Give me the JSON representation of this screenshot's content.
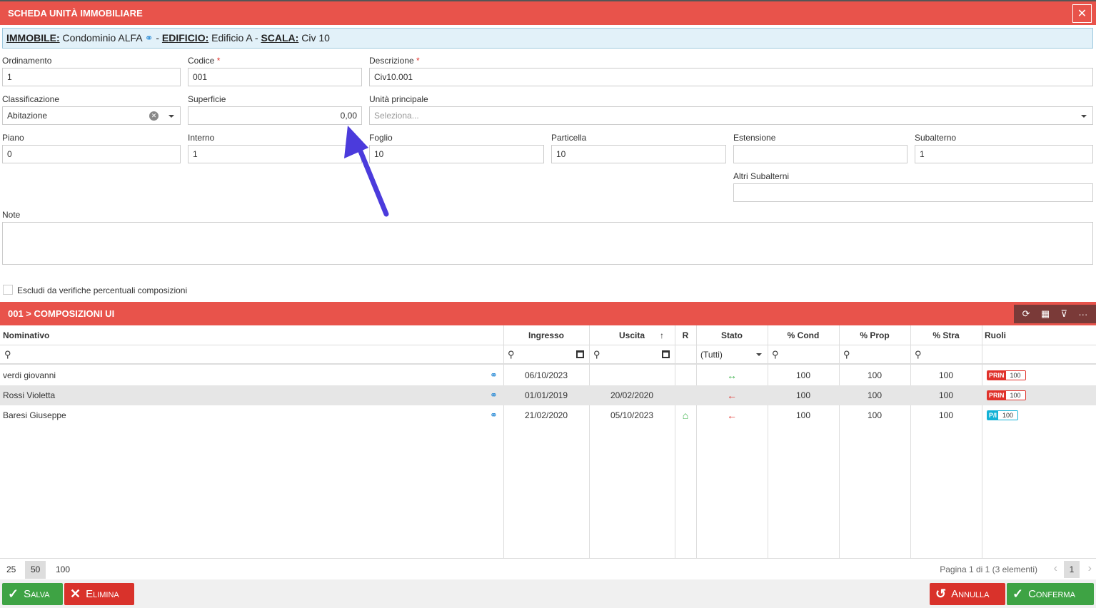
{
  "window": {
    "title": "SCHEDA UNITÀ IMMOBILIARE",
    "close_icon": "close-icon"
  },
  "info": {
    "immobile_label": "IMMOBILE:",
    "immobile_value": "Condominio ALFA",
    "edificio_label": "EDIFICIO:",
    "edificio_value": "Edificio A",
    "scala_label": "SCALA:",
    "scala_value": "Civ 10",
    "sep": "-"
  },
  "form": {
    "ordinamento": {
      "label": "Ordinamento",
      "value": "1"
    },
    "codice": {
      "label": "Codice",
      "value": "001",
      "req": "*"
    },
    "descrizione": {
      "label": "Descrizione",
      "value": "Civ10.001",
      "req": "*"
    },
    "classificazione": {
      "label": "Classificazione",
      "value": "Abitazione"
    },
    "superficie": {
      "label": "Superficie",
      "value": "0,00"
    },
    "unita_principale": {
      "label": "Unità principale",
      "placeholder": "Seleziona..."
    },
    "piano": {
      "label": "Piano",
      "value": "0"
    },
    "interno": {
      "label": "Interno",
      "value": "1"
    },
    "foglio": {
      "label": "Foglio",
      "value": "10"
    },
    "particella": {
      "label": "Particella",
      "value": "10"
    },
    "estensione": {
      "label": "Estensione",
      "value": ""
    },
    "subalterno": {
      "label": "Subalterno",
      "value": "1"
    },
    "altri_subalterni": {
      "label": "Altri Subalterni",
      "value": ""
    },
    "note": {
      "label": "Note",
      "value": ""
    },
    "escludi": {
      "label": "Escludi da verifiche percentuali composizioni",
      "checked": false
    }
  },
  "grid": {
    "title": "001 > COMPOSIZIONI UI",
    "tools": {
      "refresh": "⟳",
      "columns": "▦",
      "filter": "⊽",
      "more": "···"
    },
    "columns": {
      "nominativo": "Nominativo",
      "ingresso": "Ingresso",
      "uscita": "Uscita",
      "r": "R",
      "stato": "Stato",
      "cond": "% Cond",
      "prop": "% Prop",
      "stra": "% Stra",
      "ruoli": "Ruoli"
    },
    "sort_indicator": "↑",
    "stato_filter": "(Tutti)",
    "rows": [
      {
        "nominativo": "verdi giovanni",
        "ingresso": "06/10/2023",
        "uscita": "",
        "r": "",
        "stato": "↔",
        "cond": "100",
        "prop": "100",
        "stra": "100",
        "ruolo_k": "PRIN",
        "ruolo_v": "100"
      },
      {
        "nominativo": "Rossi Violetta",
        "ingresso": "01/01/2019",
        "uscita": "20/02/2020",
        "r": "",
        "stato": "←",
        "cond": "100",
        "prop": "100",
        "stra": "100",
        "ruolo_k": "PRIN",
        "ruolo_v": "100"
      },
      {
        "nominativo": "Baresi Giuseppe",
        "ingresso": "21/02/2020",
        "uscita": "05/10/2023",
        "r": "⌂",
        "stato": "←",
        "cond": "100",
        "prop": "100",
        "stra": "100",
        "ruolo_k": "P/I",
        "ruolo_v": "100"
      }
    ],
    "page_sizes": [
      "25",
      "50",
      "100"
    ],
    "active_page_size": "50",
    "page_info": "Pagina 1 di 1 (3 elementi)",
    "current_page": "1"
  },
  "buttons": {
    "salva": "Salva",
    "elimina": "Elimina",
    "annulla": "Annulla",
    "conferma": "Conferma"
  },
  "colors": {
    "header": "#e8534b",
    "accent_green": "#3ea344",
    "accent_red": "#d9322b",
    "annotation": "#4b3bdc"
  }
}
